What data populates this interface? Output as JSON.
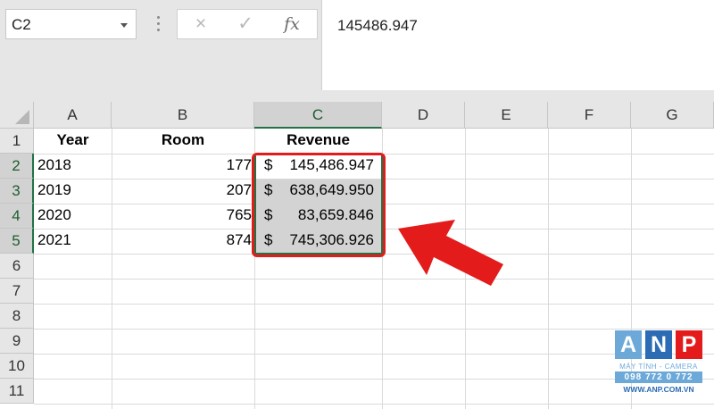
{
  "formula_bar": {
    "name_box": "C2",
    "cancel_icon": "×",
    "enter_icon": "✓",
    "fx_label": "fx",
    "formula_value": "145486.947"
  },
  "columns": [
    "A",
    "B",
    "C",
    "D",
    "E",
    "F",
    "G"
  ],
  "rows": [
    "1",
    "2",
    "3",
    "4",
    "5",
    "6",
    "7",
    "8",
    "9",
    "10",
    "11"
  ],
  "headers": {
    "year": "Year",
    "room": "Room",
    "revenue": "Revenue"
  },
  "data_rows": [
    {
      "year": "2018",
      "room": "177",
      "currency": "$",
      "revenue": "145,486.947"
    },
    {
      "year": "2019",
      "room": "207",
      "currency": "$",
      "revenue": "638,649.950"
    },
    {
      "year": "2020",
      "room": "765",
      "currency": "$",
      "revenue": "83,659.846"
    },
    {
      "year": "2021",
      "room": "874",
      "currency": "$",
      "revenue": "745,306.926"
    }
  ],
  "selection": {
    "active_cell": "C2",
    "range": "C2:C5"
  },
  "colors": {
    "highlight": "#e31b1b",
    "excel_green": "#217346",
    "selection_fill": "#d3d3d3"
  },
  "logo": {
    "letters": [
      "A",
      "N",
      "P"
    ],
    "subtitle": "MÁY TÍNH - CAMERA",
    "phone": "098 772 0 772",
    "website": "WWW.ANP.COM.VN"
  }
}
